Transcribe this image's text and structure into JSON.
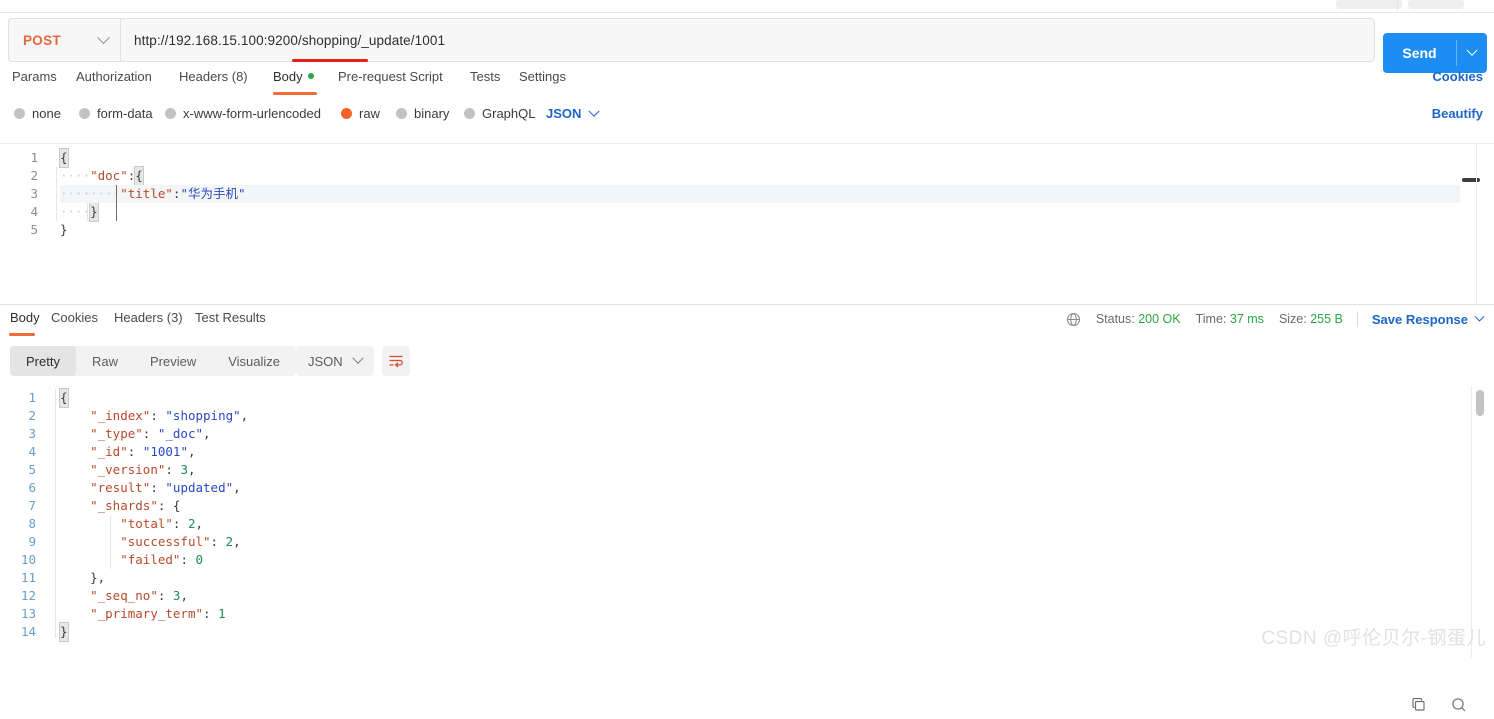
{
  "request": {
    "method": "POST",
    "url": "http://192.168.15.100:9200/shopping/_update/1001",
    "send_label": "Send",
    "tabs": [
      {
        "label": "Params",
        "active": false
      },
      {
        "label": "Authorization",
        "active": false
      },
      {
        "label": "Headers (8)",
        "active": false
      },
      {
        "label": "Body",
        "active": true,
        "dot": true
      },
      {
        "label": "Pre-request Script",
        "active": false
      },
      {
        "label": "Tests",
        "active": false
      },
      {
        "label": "Settings",
        "active": false
      }
    ],
    "cookies_link": "Cookies",
    "beautify_link": "Beautify",
    "body_types": [
      {
        "label": "none",
        "selected": false
      },
      {
        "label": "form-data",
        "selected": false
      },
      {
        "label": "x-www-form-urlencoded",
        "selected": false
      },
      {
        "label": "raw",
        "selected": true
      },
      {
        "label": "binary",
        "selected": false
      },
      {
        "label": "GraphQL",
        "selected": false
      }
    ],
    "raw_format": "JSON",
    "body_line_numbers": [
      "1",
      "2",
      "3",
      "4",
      "5"
    ],
    "body_lines": [
      "{",
      "    \"doc\":{",
      "        \"title\":\"华为手机\"",
      "    }",
      "}"
    ],
    "body_text": "{\n    \"doc\":{\n        \"title\":\"华为手机\"\n    }\n}"
  },
  "response": {
    "tabs": [
      {
        "label": "Body",
        "active": true
      },
      {
        "label": "Cookies",
        "active": false
      },
      {
        "label": "Headers (3)",
        "active": false
      },
      {
        "label": "Test Results",
        "active": false
      }
    ],
    "status_label": "Status:",
    "status_value": "200 OK",
    "time_label": "Time:",
    "time_value": "37 ms",
    "size_label": "Size:",
    "size_value": "255 B",
    "save_response_label": "Save Response",
    "view_modes": [
      {
        "label": "Pretty",
        "selected": true
      },
      {
        "label": "Raw",
        "selected": false
      },
      {
        "label": "Preview",
        "selected": false
      },
      {
        "label": "Visualize",
        "selected": false
      }
    ],
    "format": "JSON",
    "line_numbers": [
      "1",
      "2",
      "3",
      "4",
      "5",
      "6",
      "7",
      "8",
      "9",
      "10",
      "11",
      "12",
      "13",
      "14"
    ],
    "body_text": "{\n    \"_index\": \"shopping\",\n    \"_type\": \"_doc\",\n    \"_id\": \"1001\",\n    \"_version\": 3,\n    \"result\": \"updated\",\n    \"_shards\": {\n        \"total\": 2,\n        \"successful\": 2,\n        \"failed\": 0\n    },\n    \"_seq_no\": 3,\n    \"_primary_term\": 1\n}",
    "fields": {
      "_index": "shopping",
      "_type": "_doc",
      "_id": "1001",
      "_version": 3,
      "result": "updated",
      "_shards": {
        "total": 2,
        "successful": 2,
        "failed": 0
      },
      "_seq_no": 3,
      "_primary_term": 1
    }
  },
  "watermark": "CSDN @呼伦贝尔-钢蛋儿",
  "colors": {
    "send_blue": "#1d8cf3",
    "link_blue": "#1d66c9",
    "accent_orange": "#f26b3a",
    "status_green": "#2aa843",
    "annotation_red": "#e8201a"
  }
}
